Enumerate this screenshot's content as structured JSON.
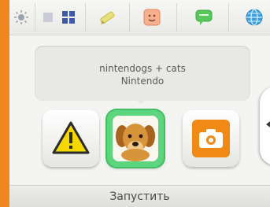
{
  "topbar": {
    "icons": [
      {
        "name": "brightness-icon"
      },
      {
        "name": "grid-small-icon"
      },
      {
        "name": "grid-large-icon"
      },
      {
        "name": "pencil-icon"
      },
      {
        "name": "mii-icon"
      },
      {
        "name": "chat-icon"
      },
      {
        "name": "globe-icon"
      }
    ]
  },
  "info": {
    "title": "nintendogs + cats",
    "publisher": "Nintendo"
  },
  "tiles": [
    {
      "name": "warning-icon"
    },
    {
      "name": "puppy-icon"
    },
    {
      "name": "camera-icon"
    }
  ],
  "bottom": {
    "launch_label": "Запустить"
  },
  "colors": {
    "frame": "#f0861f",
    "selection": "#5fd47f",
    "camera": "#f08a14",
    "warning": "#f6d800"
  }
}
